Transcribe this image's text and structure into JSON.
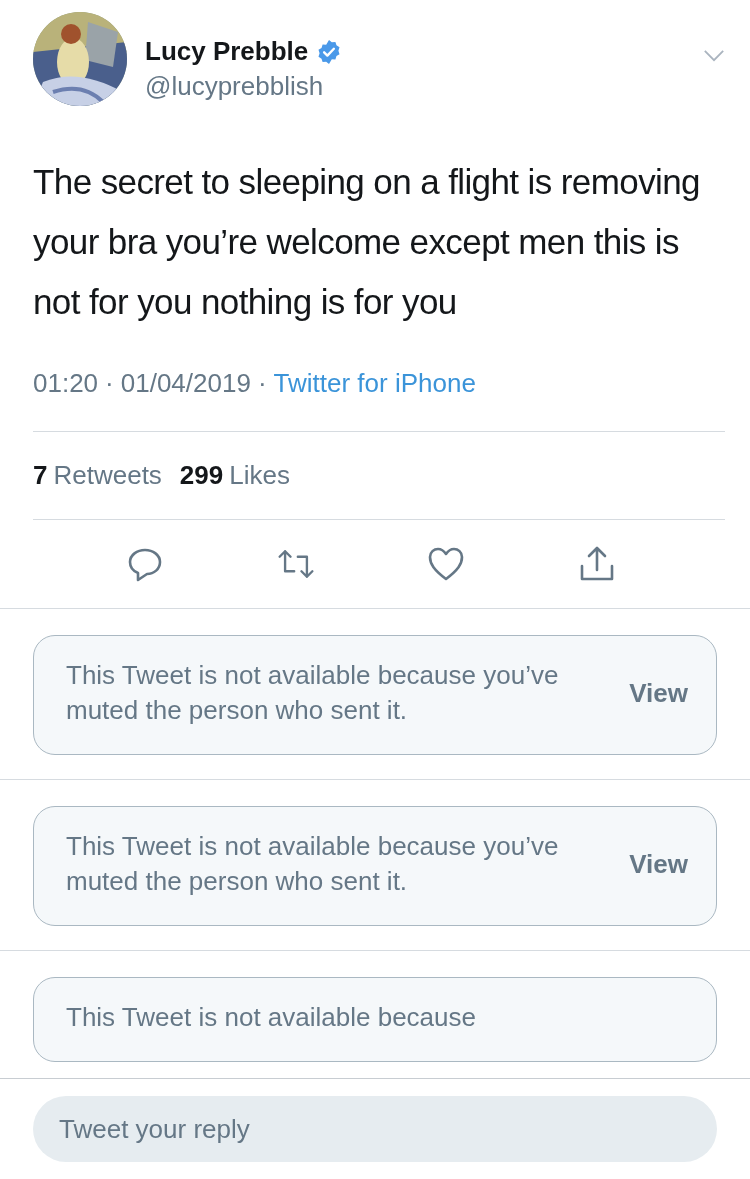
{
  "author": {
    "name": "Lucy Prebble",
    "handle": "@lucyprebblish",
    "verified": true
  },
  "tweet": {
    "text": "The secret to sleeping on a flight is removing your bra you’re welcome except men this is not for you nothing is for you",
    "time": "01:20",
    "date": "01/04/2019",
    "separator": "·",
    "source": "Twitter for iPhone"
  },
  "stats": [
    {
      "count": "7",
      "label": "Retweets"
    },
    {
      "count": "299",
      "label": "Likes"
    }
  ],
  "muted_replies": [
    {
      "message": "This Tweet is not available because you’ve muted the person who sent it.",
      "action": "View"
    },
    {
      "message": "This Tweet is not available because you’ve muted the person who sent it.",
      "action": "View"
    },
    {
      "message": "This Tweet is not available because"
    }
  ],
  "reply": {
    "placeholder": "Tweet your reply"
  }
}
